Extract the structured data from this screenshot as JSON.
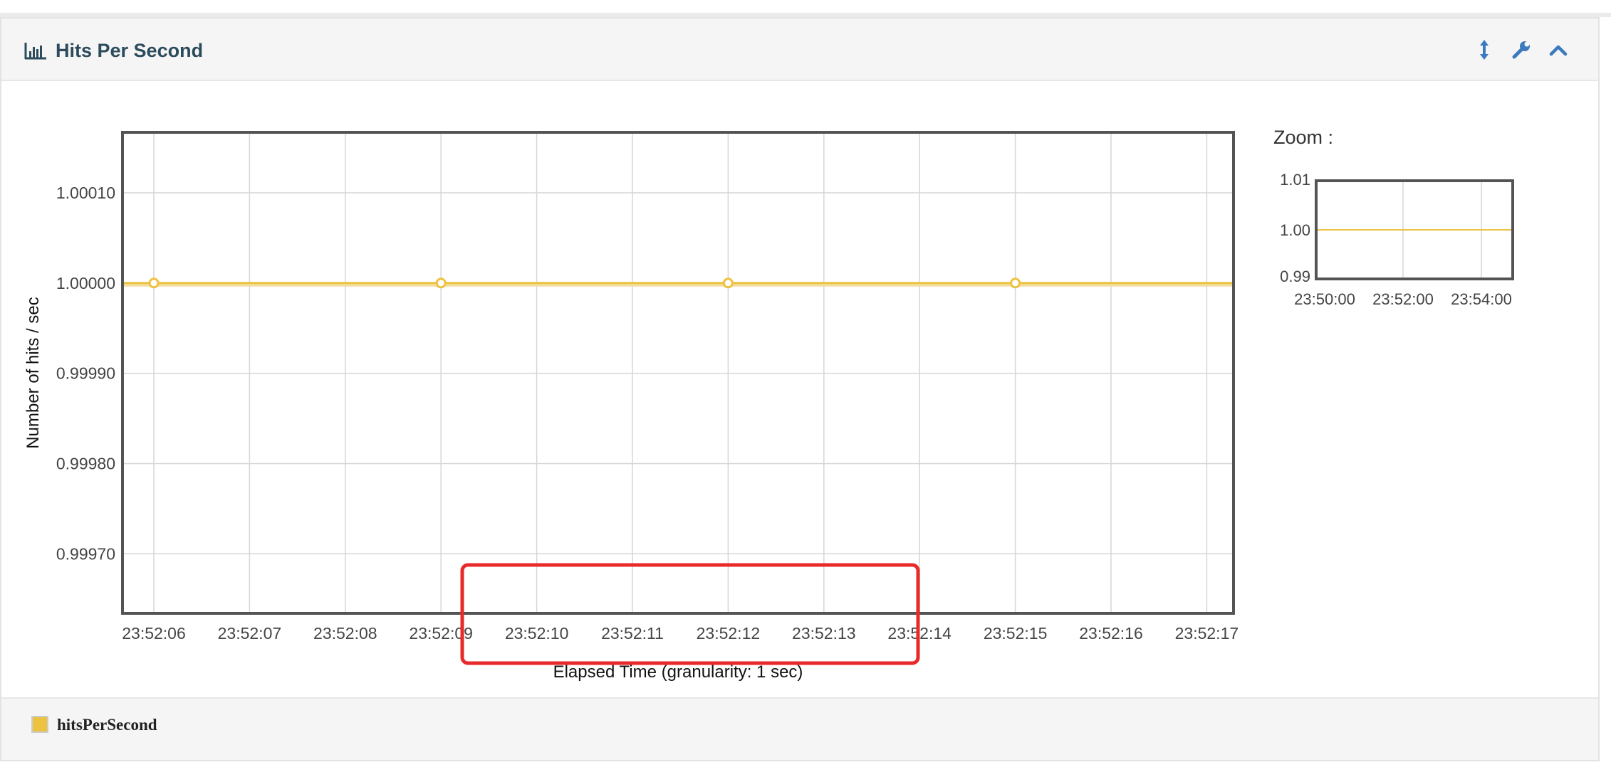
{
  "panel": {
    "title": "Hits Per Second",
    "title_icon": "bar-chart-icon",
    "buttons": [
      {
        "name": "expand-vertical-button",
        "icon": "arrows-vertical-icon"
      },
      {
        "name": "settings-button",
        "icon": "wrench-icon"
      },
      {
        "name": "collapse-button",
        "icon": "chevron-up-icon"
      }
    ],
    "accent_color": "#3a7abd"
  },
  "zoom": {
    "label": "Zoom :"
  },
  "legend": {
    "label": "hitsPerSecond",
    "color": "#edc240"
  },
  "chart_data": [
    {
      "type": "line",
      "title": "",
      "xlabel": "Elapsed Time (granularity: 1 sec)",
      "ylabel": "Number of hits / sec",
      "x_ticks": [
        "23:52:06",
        "23:52:07",
        "23:52:08",
        "23:52:09",
        "23:52:10",
        "23:52:11",
        "23:52:12",
        "23:52:13",
        "23:52:14",
        "23:52:15",
        "23:52:16",
        "23:52:17"
      ],
      "y_ticks": [
        "1.00010",
        "1.00000",
        "0.99990",
        "0.99980",
        "0.99970"
      ],
      "ylim": [
        0.999634,
        1.000167
      ],
      "grid": true,
      "series": [
        {
          "name": "hitsPerSecond",
          "color": "#edc240",
          "points": [
            {
              "x": "23:52:06",
              "y": 1.0
            },
            {
              "x": "23:52:09",
              "y": 1.0
            },
            {
              "x": "23:52:12",
              "y": 1.0
            },
            {
              "x": "23:52:15",
              "y": 1.0
            }
          ]
        }
      ],
      "line_extends_full_width": true
    },
    {
      "type": "line",
      "title": "",
      "x_ticks": [
        "23:50:00",
        "23:52:00",
        "23:54:00"
      ],
      "y_ticks": [
        "1.01",
        "1.00",
        "0.99"
      ],
      "ylim": [
        0.99,
        1.01
      ],
      "grid": true,
      "series": [
        {
          "name": "hitsPerSecond",
          "color": "#edc240",
          "y": 1.0
        }
      ]
    }
  ],
  "annotation": {
    "color": "#e82a2a"
  }
}
